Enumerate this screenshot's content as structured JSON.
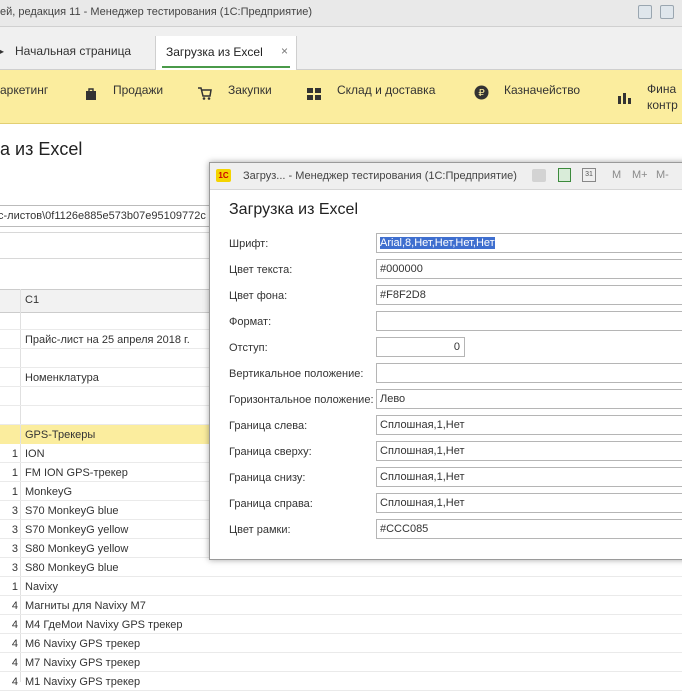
{
  "window": {
    "title": "ей, редакция 11  - Менеджер тестирования (1С:Предприятие)"
  },
  "tabs": [
    {
      "label": "Начальная страница"
    },
    {
      "label": "Загрузка из Excel",
      "close": "×"
    }
  ],
  "menu": [
    {
      "label": "аркетинг",
      "icon": ""
    },
    {
      "label": "Продажи",
      "icon": "bag-icon"
    },
    {
      "label": "Закупки",
      "icon": "cart-icon"
    },
    {
      "label": "Склад и доставка",
      "icon": "warehouse-icon"
    },
    {
      "label": "Казначейство",
      "icon": "ruble-icon"
    },
    {
      "label": "Фина",
      "label2": "контр",
      "icon": "chart-icon"
    }
  ],
  "page": {
    "title": "а из Excel",
    "path": "с-листов\\0f1126e885e573b07e95109772c"
  },
  "grid": {
    "column_header": "C1",
    "top_cells": [
      "Прайс-лист на 25 апреля 2018 г.",
      "Номенклатура"
    ],
    "rows": [
      {
        "n": "",
        "v": "GPS-Трекеры",
        "highlight": true
      },
      {
        "n": "1",
        "v": "ION"
      },
      {
        "n": "1",
        "v": "FM ION GPS-трекер"
      },
      {
        "n": "1",
        "v": "MonkeyG"
      },
      {
        "n": "3",
        "v": "S70 MonkeyG blue"
      },
      {
        "n": "3",
        "v": "S70 MonkeyG yellow"
      },
      {
        "n": "3",
        "v": "S80 MonkeyG yellow"
      },
      {
        "n": "3",
        "v": "S80 MonkeyG blue"
      },
      {
        "n": "1",
        "v": "Navixy"
      },
      {
        "n": "4",
        "v": "Магниты для Navixy M7"
      },
      {
        "n": "4",
        "v": "M4 ГдеМои Navixy GPS трекер"
      },
      {
        "n": "4",
        "v": "M6 Navixy GPS трекер"
      },
      {
        "n": "4",
        "v": "M7 Navixy GPS трекер"
      },
      {
        "n": "4",
        "v": "M1 Navixy GPS трекер"
      }
    ]
  },
  "dialog": {
    "title": "Загруз...  - Менеджер тестирования (1С:Предприятие)",
    "tools": [
      "M",
      "M+",
      "M-"
    ],
    "heading": "Загрузка из Excel",
    "fields": [
      {
        "label": "Шрифт:",
        "value": "Arial,8,Нет,Нет,Нет,Нет",
        "selected": true
      },
      {
        "label": "Цвет текста:",
        "value": "#000000"
      },
      {
        "label": "Цвет фона:",
        "value": "#F8F2D8"
      },
      {
        "label": "Формат:",
        "value": ""
      },
      {
        "label": "Отступ:",
        "value": "0",
        "short": true
      },
      {
        "label": "Вертикальное положение:",
        "value": ""
      },
      {
        "label": "Горизонтальное положение:",
        "value": "Лево"
      },
      {
        "label": "Граница слева:",
        "value": "Сплошная,1,Нет"
      },
      {
        "label": "Граница сверху:",
        "value": "Сплошная,1,Нет"
      },
      {
        "label": "Граница снизу:",
        "value": "Сплошная,1,Нет"
      },
      {
        "label": "Граница справа:",
        "value": "Сплошная,1,Нет"
      },
      {
        "label": "Цвет рамки:",
        "value": "#CCC085"
      }
    ]
  },
  "colors": {
    "menu_bg": "#FBED9E",
    "accent": "#4A9A4A",
    "selection": "#3F6FCF"
  }
}
